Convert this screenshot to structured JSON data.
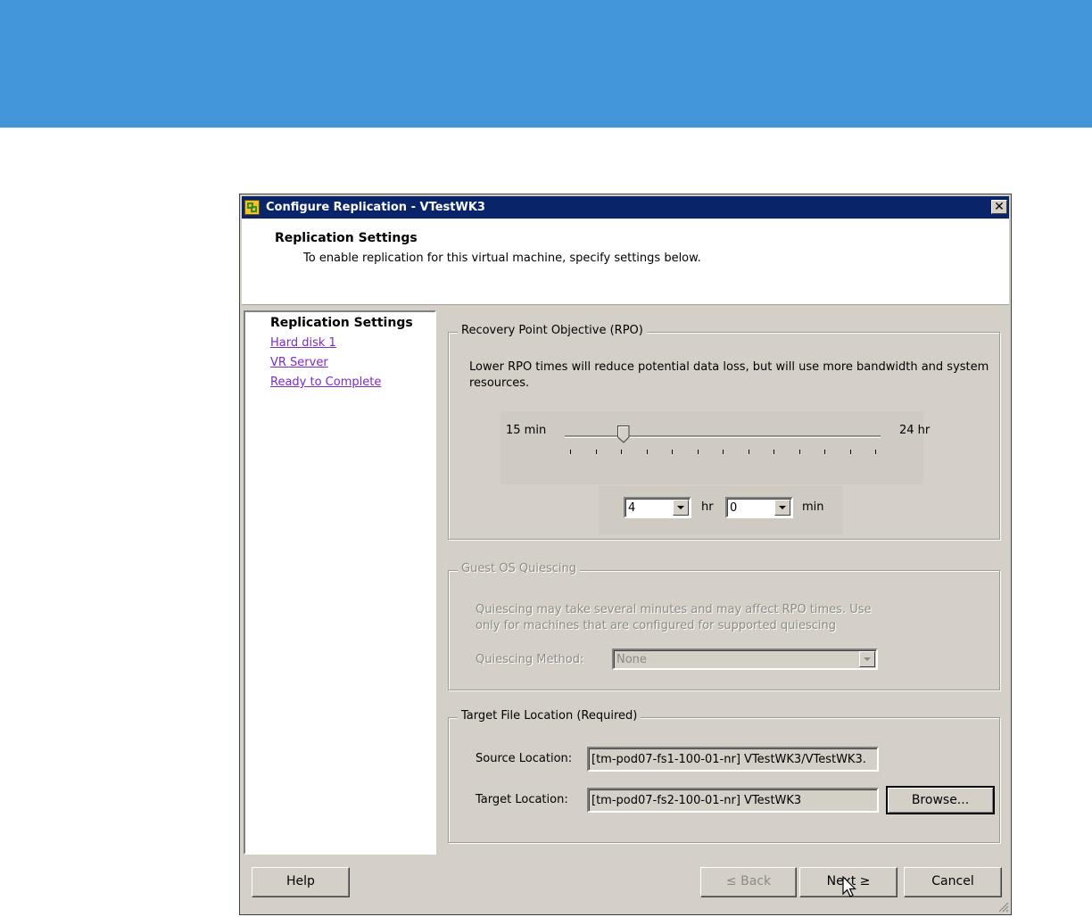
{
  "dialog": {
    "title": "Configure Replication - VTestWK3",
    "close_glyph": "✕"
  },
  "header": {
    "title": "Replication Settings",
    "subtitle": "To enable replication for this virtual machine, specify settings below."
  },
  "nav": {
    "items": [
      {
        "label": "Replication Settings",
        "state": "current"
      },
      {
        "label": "Hard disk 1",
        "state": "link"
      },
      {
        "label": "VR Server",
        "state": "link"
      },
      {
        "label": "Ready to Complete",
        "state": "link"
      }
    ]
  },
  "rpo": {
    "legend": "Recovery Point Objective (RPO)",
    "description": "Lower RPO times will reduce potential data loss, but will use more bandwidth and system resources.",
    "min_label": "15 min",
    "max_label": "24 hr",
    "hours_value": "4",
    "hours_unit": "hr",
    "minutes_value": "0",
    "minutes_unit": "min",
    "slider_fraction": 0.174,
    "tick_count": 13
  },
  "quiescing": {
    "legend": "Guest OS Quiescing",
    "description": "Quiescing may take several minutes and may affect RPO times. Use only for machines that are configured for supported quiescing",
    "method_label": "Quiescing Method:",
    "method_value": "None"
  },
  "target": {
    "legend": "Target File Location (Required)",
    "source_label": "Source Location:",
    "source_value": "[tm-pod07-fs1-100-01-nr] VTestWK3/VTestWK3.",
    "target_label": "Target Location:",
    "target_value": "[tm-pod07-fs2-100-01-nr] VTestWK3",
    "browse_label": "Browse..."
  },
  "footer": {
    "help_label": "Help",
    "back_label": "≤ Back",
    "next_label": "Next ≥",
    "cancel_label": "Cancel"
  },
  "colors": {
    "banner": "#4195d8",
    "titlebar": "#0a246a",
    "link": "#7d2ac8",
    "dialog_face": "#d4d0c8"
  }
}
